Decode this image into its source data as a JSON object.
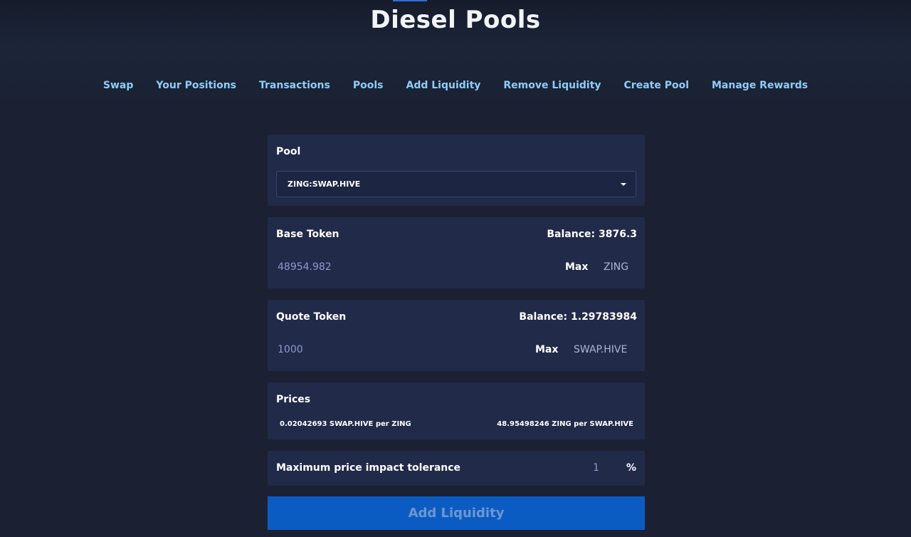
{
  "header": {
    "title": "Diesel Pools"
  },
  "nav": {
    "items": [
      {
        "label": "Swap"
      },
      {
        "label": "Your Positions"
      },
      {
        "label": "Transactions"
      },
      {
        "label": "Pools"
      },
      {
        "label": "Add Liquidity"
      },
      {
        "label": "Remove Liquidity"
      },
      {
        "label": "Create Pool"
      },
      {
        "label": "Manage Rewards"
      }
    ]
  },
  "pool": {
    "label": "Pool",
    "selected": "ZING:SWAP.HIVE"
  },
  "base": {
    "label": "Base Token",
    "balance": "Balance: 3876.3",
    "amount": "48954.982",
    "max_label": "Max",
    "symbol": "ZING"
  },
  "quote": {
    "label": "Quote Token",
    "balance": "Balance: 1.29783984",
    "amount": "1000",
    "max_label": "Max",
    "symbol": "SWAP.HIVE"
  },
  "prices": {
    "label": "Prices",
    "left": "0.02042693 SWAP.HIVE per ZING",
    "right": "48.95498246 ZING per SWAP.HIVE"
  },
  "tolerance": {
    "label": "Maximum price impact tolerance",
    "value": "1",
    "unit": "%"
  },
  "action": {
    "label": "Add Liquidity"
  },
  "colors": {
    "accent": "#0b5cc2",
    "nav_link": "#8ecdf8",
    "card": "#212a48",
    "page_bg": "#1b2133"
  }
}
